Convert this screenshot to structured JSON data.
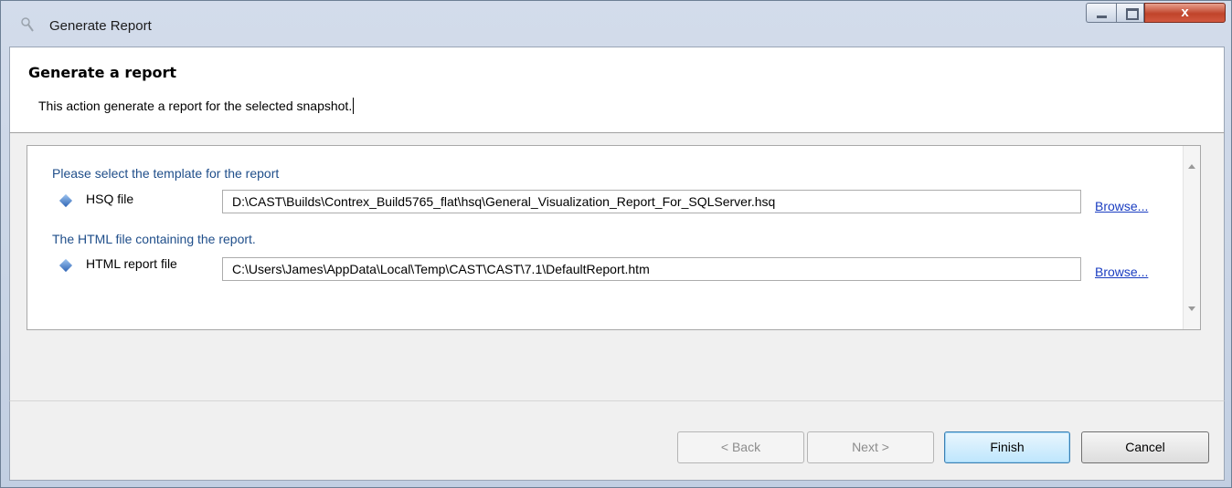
{
  "window": {
    "title": "Generate Report",
    "controls": {
      "close_glyph": "x"
    }
  },
  "header": {
    "title": "Generate a report",
    "description": "This action generate a report for the selected snapshot."
  },
  "form": {
    "template_section_label": "Please select the template for the report",
    "hsq_label": "HSQ file",
    "hsq_value": "D:\\CAST\\Builds\\Contrex_Build5765_flat\\hsq\\General_Visualization_Report_For_SQLServer.hsq",
    "html_section_label": "The HTML file containing the report.",
    "html_label": "HTML report file",
    "html_value": "C:\\Users\\James\\AppData\\Local\\Temp\\CAST\\CAST\\7.1\\DefaultReport.htm",
    "browse_label": "Browse..."
  },
  "buttons": {
    "back": "< Back",
    "next": "Next >",
    "finish": "Finish",
    "cancel": "Cancel"
  },
  "icons": {
    "app": "app-icon",
    "bullet": "diamond-bullet-icon"
  },
  "colors": {
    "section_label": "#1f4e8a",
    "link": "#1a3dc1",
    "close_button": "#c0442b"
  }
}
